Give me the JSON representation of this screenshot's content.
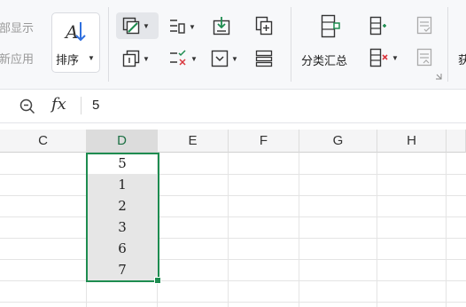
{
  "ribbon": {
    "show_all_label": "全部显示",
    "reapply_label": "重新应用",
    "sort_label": "排序",
    "subtotal_label": "分类汇总",
    "next_group_partial": "获"
  },
  "formula_bar": {
    "fx_label": "fx",
    "value": "5"
  },
  "columns": [
    "C",
    "D",
    "E",
    "F",
    "G",
    "H"
  ],
  "selected_column": "D",
  "cells": [
    "5",
    "1",
    "2",
    "3",
    "6",
    "7"
  ],
  "colors": {
    "selection": "#1e8c50"
  }
}
